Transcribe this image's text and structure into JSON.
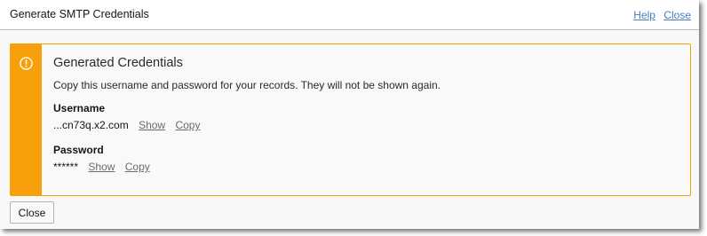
{
  "dialog": {
    "title": "Generate SMTP Credentials",
    "help_link": "Help",
    "close_link": "Close"
  },
  "banner": {
    "accent_color": "#f7a00b",
    "icon": "warning-circle-icon",
    "title": "Generated Credentials",
    "message": "Copy this username and password for your records. They will not be shown again.",
    "username": {
      "label": "Username",
      "value": "...cn73q.x2.com",
      "show_label": "Show",
      "copy_label": "Copy"
    },
    "password": {
      "label": "Password",
      "value": "******",
      "show_label": "Show",
      "copy_label": "Copy"
    }
  },
  "footer": {
    "close_button": "Close"
  }
}
